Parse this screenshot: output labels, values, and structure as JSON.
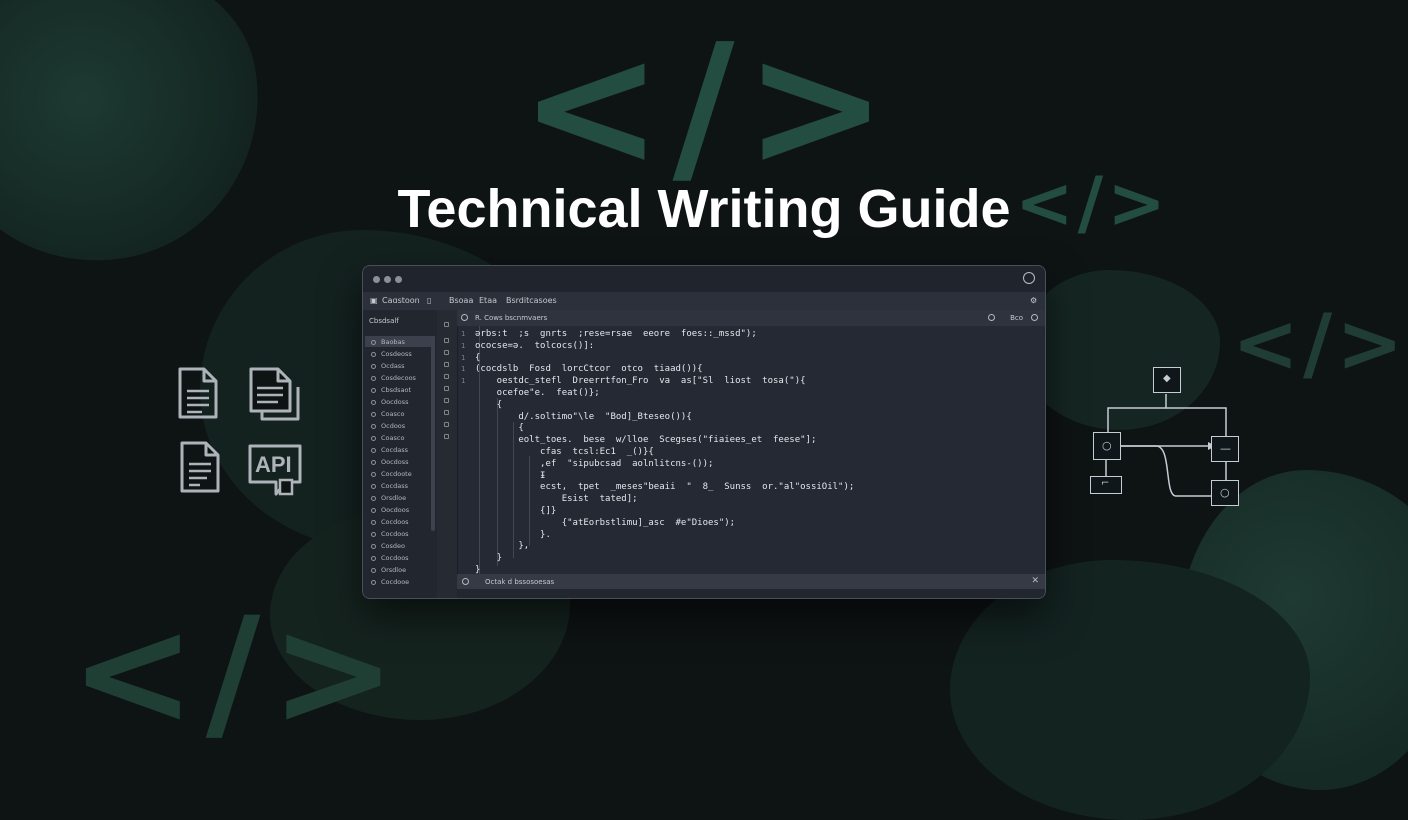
{
  "title": "Technical Writing Guide",
  "background": {
    "color": "#0e1314",
    "accent": "#234d40",
    "tag_glyph": "</>"
  },
  "icons_left": [
    {
      "name": "document-icon"
    },
    {
      "name": "documents-stack-icon"
    },
    {
      "name": "document-text-icon"
    },
    {
      "name": "api-doc-icon",
      "label": "API"
    }
  ],
  "editor": {
    "menubar": {
      "app_label": "Caɑstoon",
      "items": [
        "Bsoaa",
        "Etaa",
        "Bsrditcasoes"
      ]
    },
    "sidebar": {
      "header": "Cbsdsalf",
      "items": [
        "Baobas",
        "Cosdeoss",
        "Ocdass",
        "Cosdecoos",
        "Cbsdsaot",
        "Oocdoss",
        "Coasco",
        "Ocdoos",
        "Coasco",
        "Cocdass",
        "Oocdoss",
        "Cocdoote",
        "Cocdass",
        "Orsdloe",
        "Oocdoos",
        "Cocdoos",
        "Cocdoos",
        "Cosdeo",
        "Cocdoos",
        "Orsdloe",
        "Cocdooe"
      ]
    },
    "tab": {
      "title": "R. Cows bscnmvaers",
      "right_label": "Bco"
    },
    "code_lines": [
      "ərbs:t  ;s  gnrts  ;rese=rsae  eeore  foes::_mssd\");",
      "ococse=ə.  tolcocs()]:",
      "{",
      "(cocdslb  Fosd  lorcCtcor  otco  tiaad()){",
      "    oestdc_stefl  Dreerrtfon_Fro  va  as[\"Sl  liost  tosa(\"){",
      "    ocefoe\"e.  feat()};",
      "    {",
      "        d/.soltimo\"\\le  \"Bod]_Bteseo()){",
      "        {",
      "        eolt_toes.  bese  w/lloe  Scegses(\"fiaiees_et  feese\"];",
      "            cfas  tcsl:Ec1  _()}{",
      "            ,ef  \"sipubcsad  aolnlitcns-());",
      "            Ɨ",
      "            ecst,  tpet  _meses\"beaii  \"  8_  Sunss  or.\"al\"ossiOil\");",
      "                Esist  tated];",
      "            {]}",
      "                {\"atEorbstlimu]_asc  #e\"Dioes\");",
      "            }.",
      "        },",
      "    }",
      "}"
    ],
    "statusbar": {
      "text": "Octak  d  bssosoesas"
    }
  },
  "diagram": {
    "node_symbols": [
      "◆",
      "○",
      "—",
      "○"
    ]
  }
}
